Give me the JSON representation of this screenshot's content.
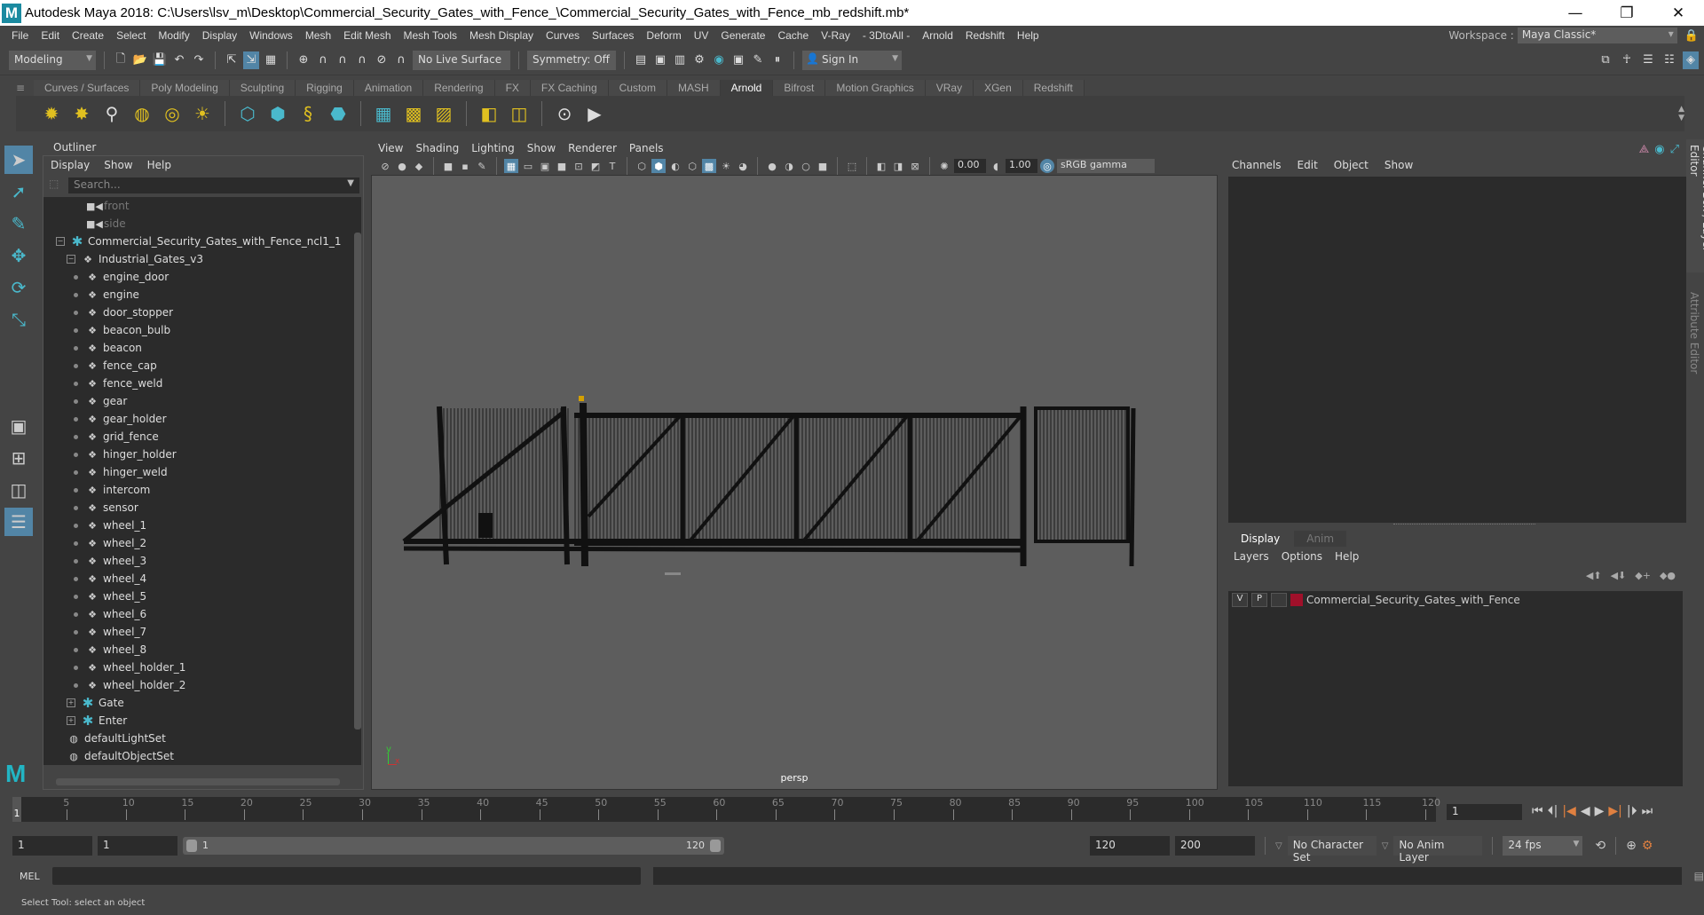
{
  "window": {
    "title": "Autodesk Maya 2018: C:\\Users\\lsv_m\\Desktop\\Commercial_Security_Gates_with_Fence_\\Commercial_Security_Gates_with_Fence_mb_redshift.mb*",
    "logo": "M",
    "minimize": "—",
    "maximize": "❐",
    "close": "✕"
  },
  "menubar": {
    "items": [
      "File",
      "Edit",
      "Create",
      "Select",
      "Modify",
      "Display",
      "Windows",
      "Mesh",
      "Edit Mesh",
      "Mesh Tools",
      "Mesh Display",
      "Curves",
      "Surfaces",
      "Deform",
      "UV",
      "Generate",
      "Cache",
      "V-Ray",
      "- 3DtoAll -",
      "Arnold",
      "Redshift",
      "Help"
    ],
    "workspace_label": "Workspace :",
    "workspace_value": "Maya Classic*"
  },
  "statusline": {
    "mode": "Modeling",
    "live_surface": "No Live Surface",
    "symmetry": "Symmetry: Off",
    "sign_in": "Sign In"
  },
  "shelf": {
    "tabs": [
      "Curves / Surfaces",
      "Poly Modeling",
      "Sculpting",
      "Rigging",
      "Animation",
      "Rendering",
      "FX",
      "FX Caching",
      "Custom",
      "MASH",
      "Arnold",
      "Bifrost",
      "Motion Graphics",
      "VRay",
      "XGen",
      "Redshift"
    ],
    "active_tab": "Arnold"
  },
  "outliner": {
    "tab": "Outliner",
    "menu": [
      "Display",
      "Show",
      "Help"
    ],
    "search_placeholder": "Search...",
    "items": [
      {
        "label": "front",
        "type": "camera",
        "depth": 1,
        "dim": true
      },
      {
        "label": "side",
        "type": "camera",
        "depth": 1,
        "dim": true
      },
      {
        "label": "Commercial_Security_Gates_with_Fence_ncl1_1",
        "type": "group",
        "depth": 0,
        "expand": "−"
      },
      {
        "label": "Industrial_Gates_v3",
        "type": "mesh",
        "depth": 1,
        "expand": "−"
      },
      {
        "label": "engine_door",
        "type": "mesh",
        "depth": 2
      },
      {
        "label": "engine",
        "type": "mesh",
        "depth": 2
      },
      {
        "label": "door_stopper",
        "type": "mesh",
        "depth": 2
      },
      {
        "label": "beacon_bulb",
        "type": "mesh",
        "depth": 2
      },
      {
        "label": "beacon",
        "type": "mesh",
        "depth": 2
      },
      {
        "label": "fence_cap",
        "type": "mesh",
        "depth": 2
      },
      {
        "label": "fence_weld",
        "type": "mesh",
        "depth": 2
      },
      {
        "label": "gear",
        "type": "mesh",
        "depth": 2
      },
      {
        "label": "gear_holder",
        "type": "mesh",
        "depth": 2
      },
      {
        "label": "grid_fence",
        "type": "mesh",
        "depth": 2
      },
      {
        "label": "hinger_holder",
        "type": "mesh",
        "depth": 2
      },
      {
        "label": "hinger_weld",
        "type": "mesh",
        "depth": 2
      },
      {
        "label": "intercom",
        "type": "mesh",
        "depth": 2
      },
      {
        "label": "sensor",
        "type": "mesh",
        "depth": 2
      },
      {
        "label": "wheel_1",
        "type": "mesh",
        "depth": 2
      },
      {
        "label": "wheel_2",
        "type": "mesh",
        "depth": 2
      },
      {
        "label": "wheel_3",
        "type": "mesh",
        "depth": 2
      },
      {
        "label": "wheel_4",
        "type": "mesh",
        "depth": 2
      },
      {
        "label": "wheel_5",
        "type": "mesh",
        "depth": 2
      },
      {
        "label": "wheel_6",
        "type": "mesh",
        "depth": 2
      },
      {
        "label": "wheel_7",
        "type": "mesh",
        "depth": 2
      },
      {
        "label": "wheel_8",
        "type": "mesh",
        "depth": 2
      },
      {
        "label": "wheel_holder_1",
        "type": "mesh",
        "depth": 2
      },
      {
        "label": "wheel_holder_2",
        "type": "mesh",
        "depth": 2
      },
      {
        "label": "Gate",
        "type": "group",
        "depth": 1,
        "expand": "+"
      },
      {
        "label": "Enter",
        "type": "group",
        "depth": 1,
        "expand": "+"
      },
      {
        "label": "defaultLightSet",
        "type": "set",
        "depth": 0
      },
      {
        "label": "defaultObjectSet",
        "type": "set",
        "depth": 0
      }
    ]
  },
  "viewport": {
    "menu": [
      "View",
      "Shading",
      "Lighting",
      "Show",
      "Renderer",
      "Panels"
    ],
    "exposure": "0.00",
    "gamma": "1.00",
    "color_space": "sRGB gamma",
    "camera_label": "persp",
    "axis_y": "y",
    "axis_x": "x"
  },
  "channel_box": {
    "menu": [
      "Channels",
      "Edit",
      "Object",
      "Show"
    ]
  },
  "layer_editor": {
    "tabs": [
      "Display",
      "Anim"
    ],
    "active_tab": "Display",
    "menu": [
      "Layers",
      "Options",
      "Help"
    ],
    "layers": [
      {
        "v": "V",
        "p": "P",
        "color": "#a0102a",
        "name": "Commercial_Security_Gates_with_Fence"
      }
    ]
  },
  "side_tabs": [
    "Channel Box / Layer Editor",
    "Attribute Editor"
  ],
  "timeline": {
    "ticks": [
      5,
      10,
      15,
      20,
      25,
      30,
      35,
      40,
      45,
      50,
      55,
      60,
      65,
      70,
      75,
      80,
      85,
      90,
      95,
      100,
      105,
      110,
      115,
      120
    ],
    "start": 1,
    "end": 120,
    "current_frame_marker": "1",
    "current_frame": "1"
  },
  "range": {
    "start": "1",
    "playback_start": "1",
    "slider_start": "1",
    "slider_end": "120",
    "playback_end": "120",
    "end": "200",
    "character_set": "No Character Set",
    "anim_layer": "No Anim Layer",
    "fps": "24 fps"
  },
  "command_line": {
    "label": "MEL"
  },
  "status_message": "Select Tool: select an object"
}
